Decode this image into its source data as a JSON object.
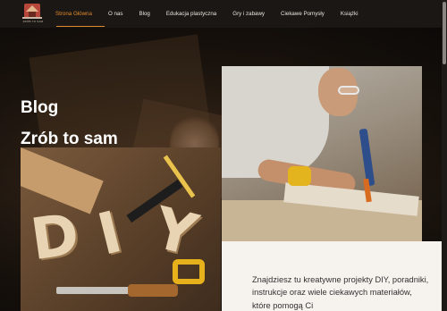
{
  "brand": {
    "logo_icon": "workshop-logo-icon",
    "tagline": "ZRÓB TO SAM",
    "colors": {
      "accent": "#e0892e",
      "topbar": "#1b1714",
      "content_bg": "#f6f3ee"
    }
  },
  "nav": {
    "items": [
      {
        "label": "Strona Główna",
        "active": true
      },
      {
        "label": "O nas",
        "active": false
      },
      {
        "label": "Blog",
        "active": false
      },
      {
        "label": "Edukacja plastyczna",
        "active": false
      },
      {
        "label": "Gry i zabawy",
        "active": false
      },
      {
        "label": "Ciekawe Pomysły",
        "active": false
      },
      {
        "label": "Książki",
        "active": false
      }
    ]
  },
  "hero": {
    "title_line1": "Blog",
    "title_line2": "Zrób to sam"
  },
  "photos": {
    "diy_letters": [
      "D",
      "I",
      "Y"
    ]
  },
  "content": {
    "text": "Znajdziesz tu kreatywne projekty DIY, poradniki, instrukcje oraz wiele ciekawych materiałów, które pomogą Ci"
  }
}
